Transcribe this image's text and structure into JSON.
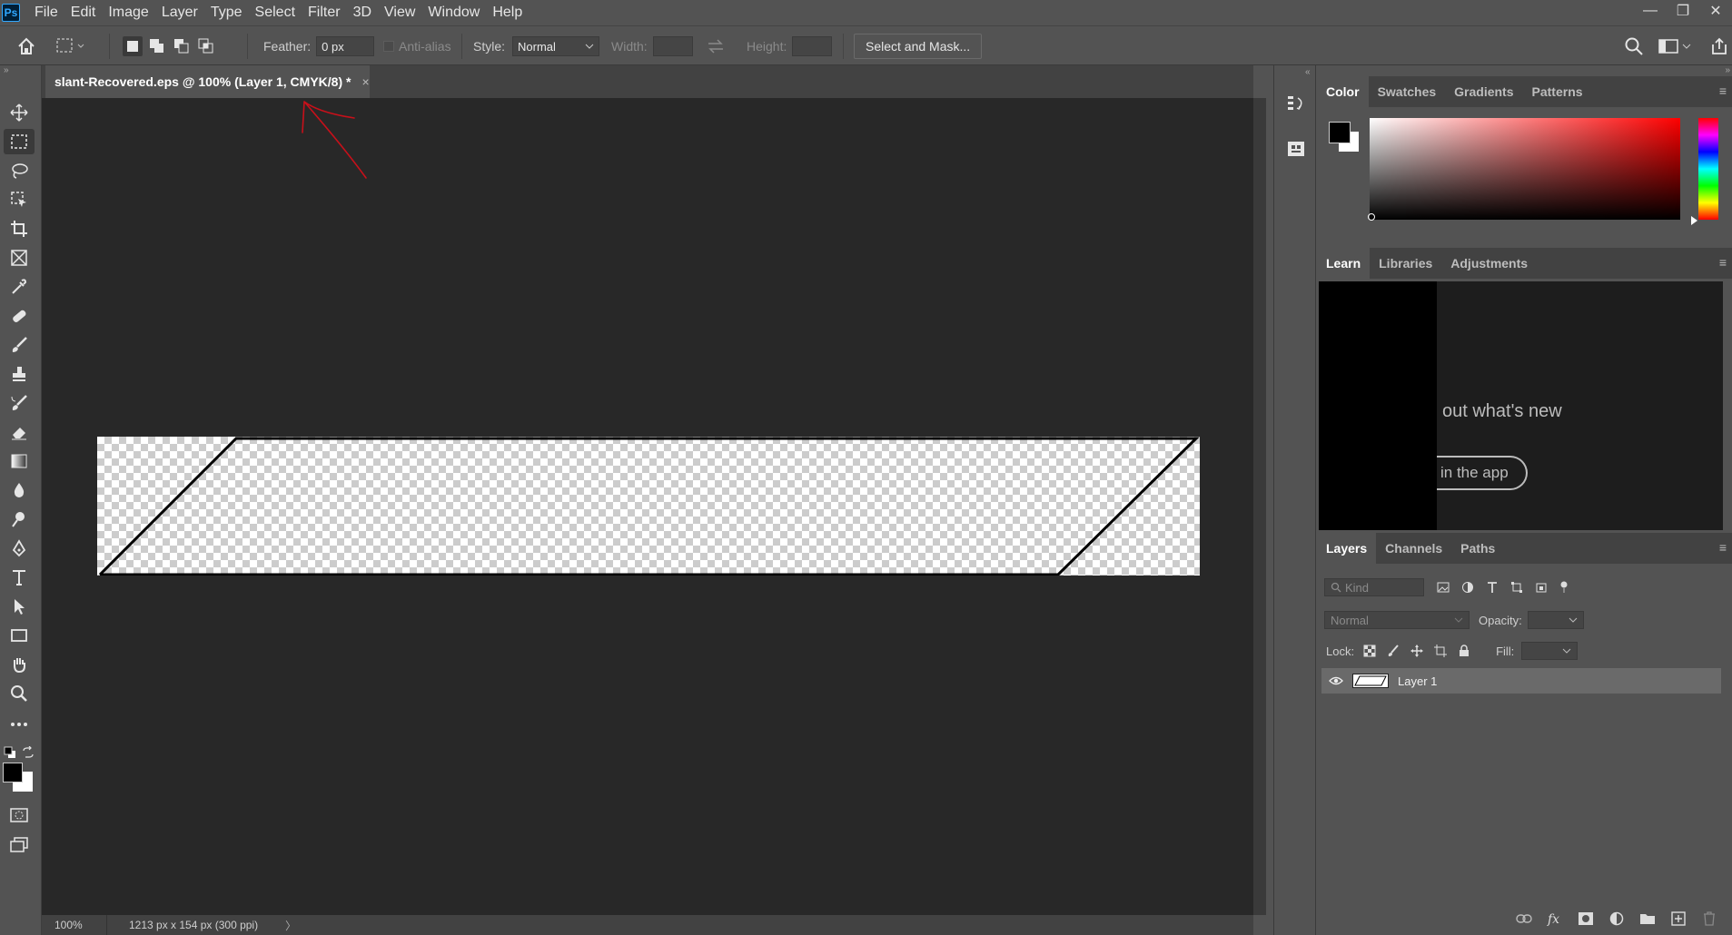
{
  "app": {
    "logo": "Ps",
    "accent_color": "#31a8ff"
  },
  "menu": [
    "File",
    "Edit",
    "Image",
    "Layer",
    "Type",
    "Select",
    "Filter",
    "3D",
    "View",
    "Window",
    "Help"
  ],
  "window_controls": {
    "minimize": "—",
    "restore": "❐",
    "close": "✕"
  },
  "options": {
    "feather_label": "Feather:",
    "feather_value": "0 px",
    "antialias_label": "Anti-alias",
    "style_label": "Style:",
    "style_value": "Normal",
    "width_label": "Width:",
    "height_label": "Height:",
    "select_mask_label": "Select and Mask..."
  },
  "document": {
    "tab_title": "slant-Recovered.eps @ 100% (Layer 1, CMYK/8) *",
    "close_glyph": "×",
    "annotation_color": "#c8101a"
  },
  "status": {
    "zoom": "100%",
    "doc_info": "1213 px x 154 px (300 ppi)",
    "arrow": "〉"
  },
  "color_panel": {
    "tabs": [
      "Color",
      "Swatches",
      "Gradients",
      "Patterns"
    ],
    "active_tab": "Color",
    "foreground": "#000000",
    "background": "#ffffff",
    "hue": "#ff0000"
  },
  "learn_panel": {
    "tabs": [
      "Learn",
      "Libraries",
      "Adjustments"
    ],
    "active_tab": "Learn",
    "headline": "out what's new",
    "button": "in the app"
  },
  "layers_panel": {
    "tabs": [
      "Layers",
      "Channels",
      "Paths"
    ],
    "active_tab": "Layers",
    "filter_placeholder": "Kind",
    "blend_mode": "Normal",
    "opacity_label": "Opacity:",
    "lock_label": "Lock:",
    "fill_label": "Fill:",
    "layers": [
      {
        "name": "Layer 1",
        "visible": true,
        "selected": true
      }
    ]
  },
  "footer_icons": [
    "link-icon",
    "fx-icon",
    "mask-icon",
    "adjustment-icon",
    "group-icon",
    "new-layer-icon",
    "delete-icon"
  ]
}
